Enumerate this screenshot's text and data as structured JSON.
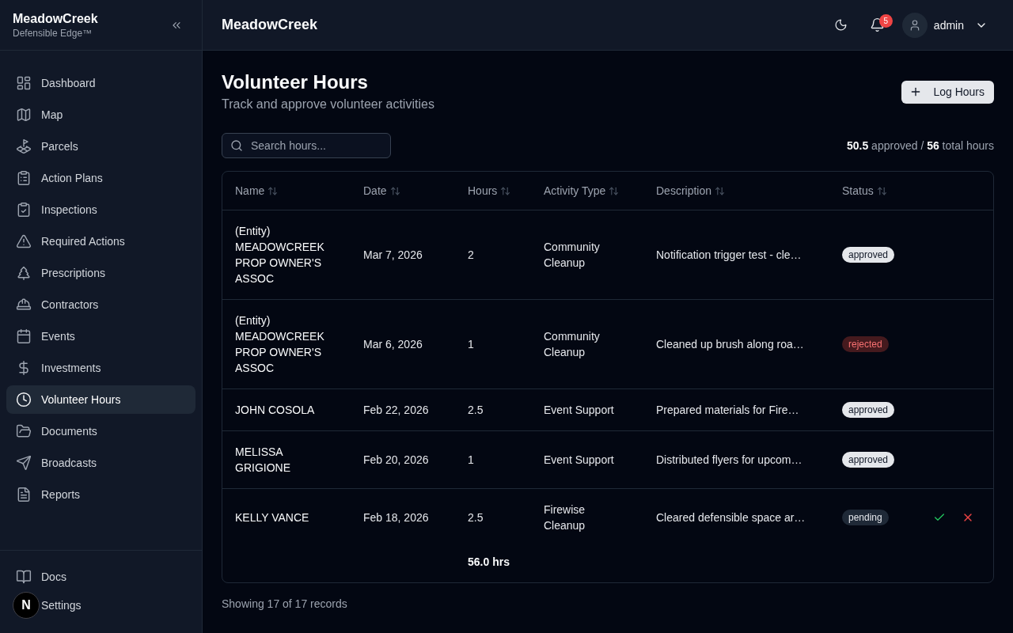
{
  "sidebar": {
    "brand": {
      "title": "MeadowCreek",
      "subtitle": "Defensible Edge™"
    },
    "items": [
      {
        "label": "Dashboard",
        "selected": false
      },
      {
        "label": "Map",
        "selected": false
      },
      {
        "label": "Parcels",
        "selected": false
      },
      {
        "label": "Action Plans",
        "selected": false
      },
      {
        "label": "Inspections",
        "selected": false
      },
      {
        "label": "Required Actions",
        "selected": false
      },
      {
        "label": "Prescriptions",
        "selected": false
      },
      {
        "label": "Contractors",
        "selected": false
      },
      {
        "label": "Events",
        "selected": false
      },
      {
        "label": "Investments",
        "selected": false
      },
      {
        "label": "Volunteer Hours",
        "selected": true
      },
      {
        "label": "Documents",
        "selected": false
      },
      {
        "label": "Broadcasts",
        "selected": false
      },
      {
        "label": "Reports",
        "selected": false
      }
    ],
    "footer_items": [
      {
        "label": "Docs",
        "selected": false
      },
      {
        "label": "Settings",
        "selected": false
      }
    ]
  },
  "header": {
    "title": "MeadowCreek",
    "notification_count": "5",
    "user": "admin"
  },
  "page": {
    "title": "Volunteer Hours",
    "subtitle": "Track and approve volunteer activities",
    "log_button": "Log Hours",
    "search": {
      "placeholder": "Search hours..."
    },
    "summary": "**50.5** approved / **56** total hours"
  },
  "table": {
    "columns": [
      "Name",
      "Date",
      "Hours",
      "Activity Type",
      "Description",
      "Status"
    ],
    "rows": [
      {
        "name": "(Entity) MEADOWCREEK PROP OWNER'S ASSOC",
        "date": "Mar 7, 2026",
        "hours": "2",
        "activity": "Community Cleanup",
        "description": "Notification trigger test - cle…",
        "status": {
          "label": "approved",
          "kind": "approved"
        },
        "reviewable": false
      },
      {
        "name": "(Entity) MEADOWCREEK PROP OWNER'S ASSOC",
        "date": "Mar 6, 2026",
        "hours": "1",
        "activity": "Community Cleanup",
        "description": "Cleaned up brush along roa…",
        "status": {
          "label": "rejected",
          "kind": "rejected"
        },
        "reviewable": false
      },
      {
        "name": "JOHN COSOLA",
        "date": "Feb 22, 2026",
        "hours": "2.5",
        "activity": "Event Support",
        "description": "Prepared materials for Fire…",
        "status": {
          "label": "approved",
          "kind": "approved"
        },
        "reviewable": false
      },
      {
        "name": "MELISSA GRIGIONE",
        "date": "Feb 20, 2026",
        "hours": "1",
        "activity": "Event Support",
        "description": "Distributed flyers for upcom…",
        "status": {
          "label": "approved",
          "kind": "approved"
        },
        "reviewable": false
      },
      {
        "name": "KELLY VANCE",
        "date": "Feb 18, 2026",
        "hours": "2.5",
        "activity": "Firewise Cleanup",
        "description": "Cleared defensible space ar…",
        "status": {
          "label": "pending",
          "kind": "pending"
        },
        "reviewable": true
      }
    ],
    "totals": {
      "hours": "56.0 hrs"
    }
  },
  "footer": "Showing 17 of 17 records",
  "dev_badge": "N"
}
